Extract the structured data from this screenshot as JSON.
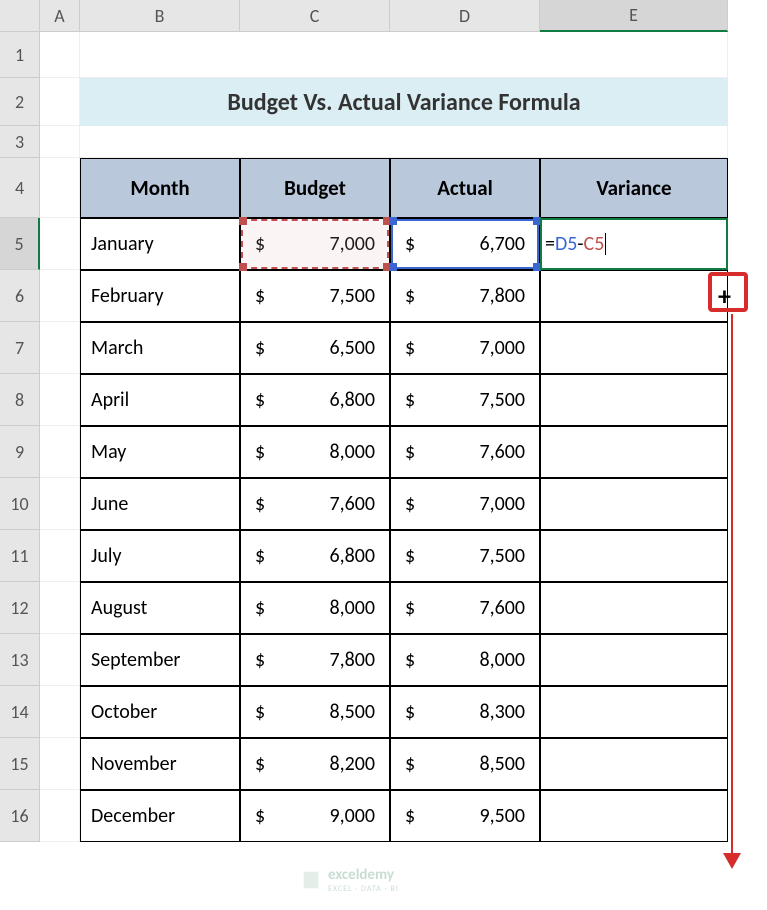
{
  "columns": [
    "A",
    "B",
    "C",
    "D",
    "E"
  ],
  "title": "Budget Vs. Actual Variance Formula",
  "headers": {
    "month": "Month",
    "budget": "Budget",
    "actual": "Actual",
    "variance": "Variance"
  },
  "rows": [
    {
      "month": "January",
      "budget": "7,000",
      "actual": "6,700"
    },
    {
      "month": "February",
      "budget": "7,500",
      "actual": "7,800"
    },
    {
      "month": "March",
      "budget": "6,500",
      "actual": "7,000"
    },
    {
      "month": "April",
      "budget": "6,800",
      "actual": "7,500"
    },
    {
      "month": "May",
      "budget": "8,000",
      "actual": "7,600"
    },
    {
      "month": "June",
      "budget": "7,600",
      "actual": "7,000"
    },
    {
      "month": "July",
      "budget": "6,800",
      "actual": "7,500"
    },
    {
      "month": "August",
      "budget": "8,000",
      "actual": "7,600"
    },
    {
      "month": "September",
      "budget": "7,800",
      "actual": "8,000"
    },
    {
      "month": "October",
      "budget": "8,500",
      "actual": "8,300"
    },
    {
      "month": "November",
      "budget": "8,200",
      "actual": "8,500"
    },
    {
      "month": "December",
      "budget": "9,000",
      "actual": "9,500"
    }
  ],
  "formula": {
    "eq": "=",
    "ref1": "D5",
    "op": "-",
    "ref2": "C5"
  },
  "currency": "$",
  "watermark": {
    "brand": "exceldemy",
    "tag": "EXCEL · DATA · BI"
  },
  "row_numbers": [
    1,
    2,
    3,
    4,
    5,
    6,
    7,
    8,
    9,
    10,
    11,
    12,
    13,
    14,
    15,
    16
  ]
}
